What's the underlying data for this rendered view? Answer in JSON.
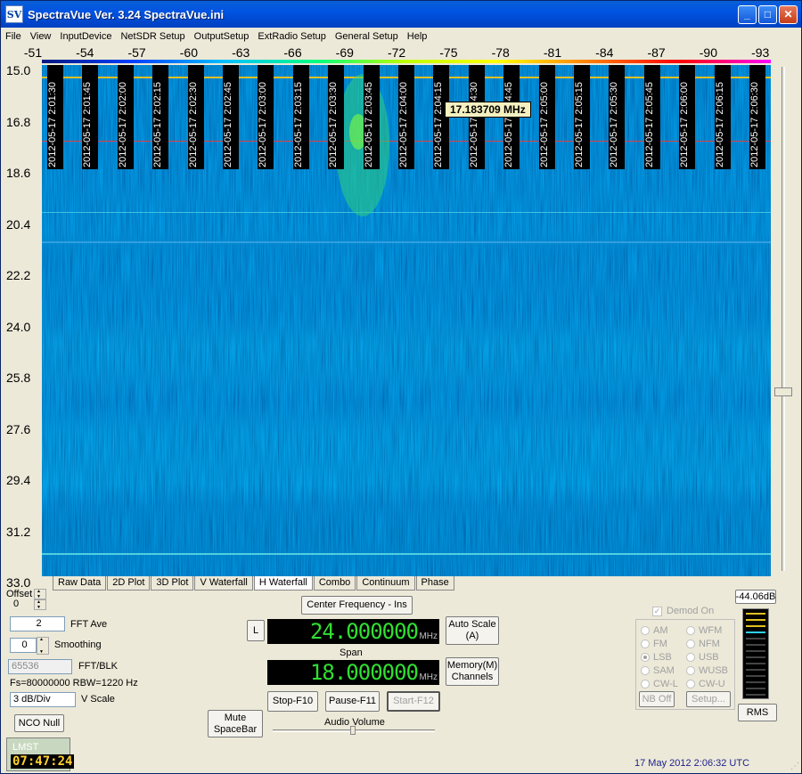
{
  "window": {
    "title": "SpectraVue Ver. 3.24  SpectraVue.ini",
    "icon": "SV"
  },
  "menu": [
    "File",
    "View",
    "InputDevice",
    "NetSDR Setup",
    "OutputSetup",
    "ExtRadio Setup",
    "General Setup",
    "Help"
  ],
  "top_scale": [
    "-51",
    "-54",
    "-57",
    "-60",
    "-63",
    "-66",
    "-69",
    "-72",
    "-75",
    "-78",
    "-81",
    "-84",
    "-87",
    "-90",
    "-93"
  ],
  "y_scale": [
    "15.0",
    "16.8",
    "18.6",
    "20.4",
    "22.2",
    "24.0",
    "25.8",
    "27.6",
    "29.4",
    "31.2",
    "33.0"
  ],
  "timestamps": [
    "2012-05-17 2:01:30",
    "2012-05-17 2:01:45",
    "2012-05-17 2:02:00",
    "2012-05-17 2:02:15",
    "2012-05-17 2:02:30",
    "2012-05-17 2:02:45",
    "2012-05-17 2:03:00",
    "2012-05-17 2:03:15",
    "2012-05-17 2:03:30",
    "2012-05-17 2:03:45",
    "2012-05-17 2:04:00",
    "2012-05-17 2:04:15",
    "2012-05-17 2:04:30",
    "2012-05-17 2:04:45",
    "2012-05-17 2:05:00",
    "2012-05-17 2:05:15",
    "2012-05-17 2:05:30",
    "2012-05-17 2:05:45",
    "2012-05-17 2:06:00",
    "2012-05-17 2:06:15",
    "2012-05-17 2:06:30"
  ],
  "freq_tooltip": "17.183709 MHz",
  "tabs": [
    "Raw Data",
    "2D Plot",
    "3D Plot",
    "V Waterfall",
    "H Waterfall",
    "Combo",
    "Continuum",
    "Phase"
  ],
  "active_tab": "H Waterfall",
  "controls": {
    "offset_label": "Offset",
    "offset_value": "0",
    "fft_ave_value": "2",
    "fft_ave_label": "FFT Ave",
    "smoothing_value": "0",
    "smoothing_label": "Smoothing",
    "fft_blk_value": "65536",
    "fft_blk_label": "FFT/BLK",
    "fs_info": "Fs=80000000 RBW=1220 Hz",
    "vscale_value": "3 dB/Div",
    "vscale_label": "V Scale",
    "nco_null": "NCO Null",
    "center_freq_button": "Center Frequency - Ins",
    "l_button": "L",
    "center_freq_value": "24.000000",
    "center_freq_unit": "MHz",
    "autoscale_button": "Auto Scale (A)",
    "span_label": "Span",
    "span_value": "18.000000",
    "span_unit": "MHz",
    "memory_button": "Memory(M) Channels",
    "stop_button": "Stop-F10",
    "pause_button": "Pause-F11",
    "start_button": "Start-F12",
    "mute_button": "Mute SpaceBar",
    "audio_volume_label": "Audio Volume"
  },
  "demod": {
    "checkbox_label": "Demod On",
    "modes_left": [
      "AM",
      "FM",
      "LSB",
      "SAM",
      "CW-L"
    ],
    "modes_right": [
      "WFM",
      "NFM",
      "USB",
      "WUSB",
      "CW-U"
    ],
    "selected": "LSB",
    "nb_off": "NB Off",
    "setup": "Setup..."
  },
  "level_readout": "-44.06dB",
  "rms_button": "RMS",
  "lmst_label": "LMST",
  "lmst_time": "07:47:24",
  "status_date": "17 May 2012  2:06:32 UTC"
}
